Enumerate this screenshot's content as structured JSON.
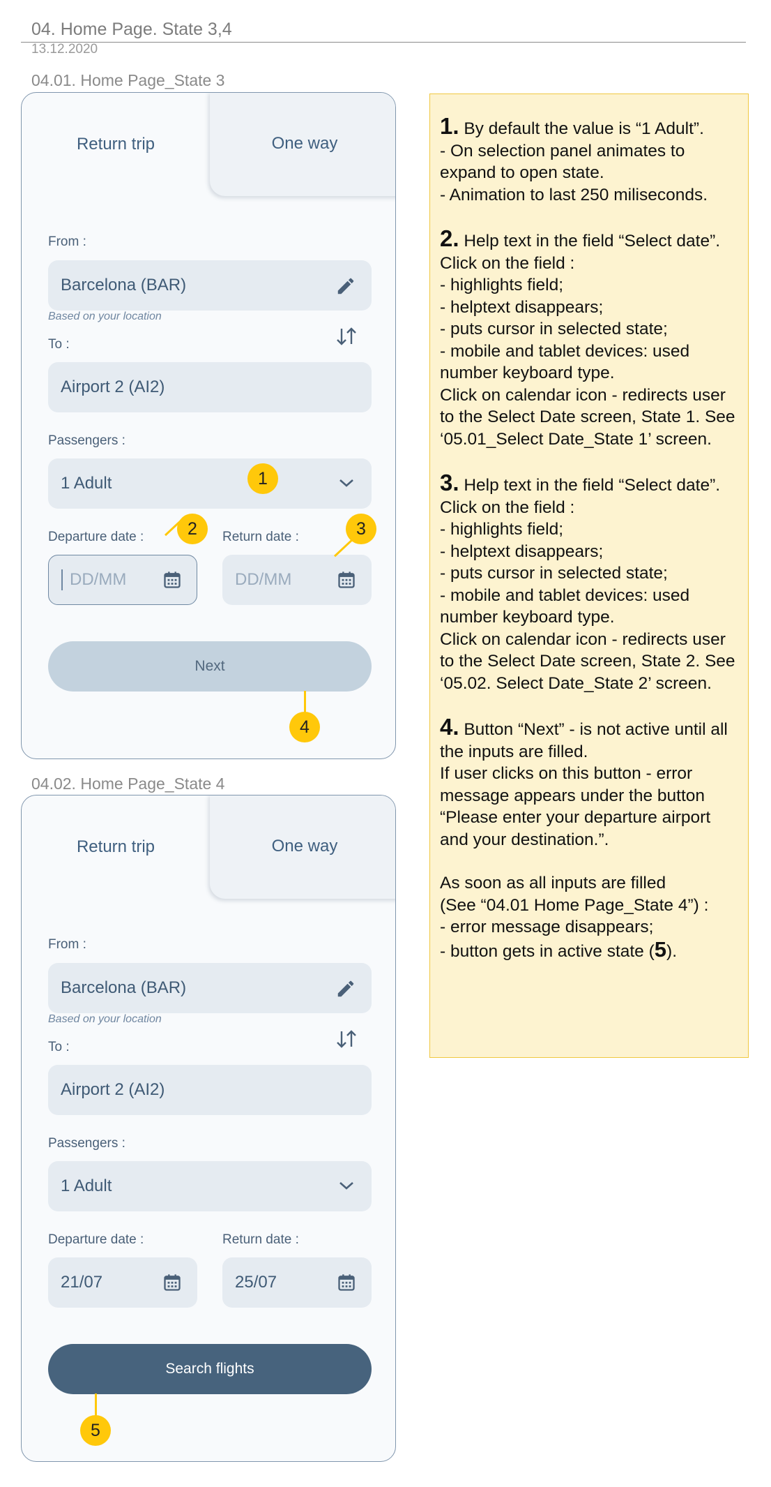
{
  "header": {
    "title": "04. Home Page. State 3,4",
    "date": "13.12.2020"
  },
  "screens": [
    {
      "section_title": "04.01. Home Page_State 3",
      "tabs": {
        "return_trip": "Return trip",
        "one_way": "One way"
      },
      "from_label": "From :",
      "from_value": "Barcelona (BAR)",
      "from_hint": "Based on your location",
      "to_label": "To :",
      "to_value": "Airport 2 (AI2)",
      "passengers_label": "Passengers :",
      "passengers_value": "1 Adult",
      "departure_label": "Departure date :",
      "departure_placeholder": "DD/MM",
      "return_label": "Return date :",
      "return_placeholder": "DD/MM",
      "button_label": "Next"
    },
    {
      "section_title": "04.02. Home Page_State 4",
      "tabs": {
        "return_trip": "Return trip",
        "one_way": "One way"
      },
      "from_label": "From :",
      "from_value": "Barcelona (BAR)",
      "from_hint": "Based on your location",
      "to_label": "To :",
      "to_value": "Airport 2 (AI2)",
      "passengers_label": "Passengers :",
      "passengers_value": "1 Adult",
      "departure_label": "Departure date :",
      "departure_value": "21/07",
      "return_label": "Return date :",
      "return_value": "25/07",
      "button_label": "Search flights"
    }
  ],
  "badges": [
    "1",
    "2",
    "3",
    "4",
    "5"
  ],
  "notes": [
    {
      "num": "1.",
      "text": " By default the value is “1 Adult”.\n- On selection panel animates to expand to open state.\n- Animation to last 250 miliseconds."
    },
    {
      "num": "2.",
      "text": " Help text in the field “Select date”. Click on the field :\n - highlights field;\n - helptext disappears;\n - puts cursor in selected state;\n - mobile and tablet devices: used number keyboard type.\nClick on calendar icon - redirects user to the Select Date screen, State 1. See ‘05.01_Select Date_State 1’ screen."
    },
    {
      "num": "3.",
      "text": " Help text in the field “Select date”. Click on the field :\n - highlights field;\n - helptext disappears;\n - puts cursor in selected state;\n - mobile and tablet devices: used number keyboard type.\nClick on calendar icon - redirects user to the Select Date screen, State 2. See ‘05.02. Select Date_State 2’ screen."
    },
    {
      "num": "4.",
      "text": " Button “Next” - is not active until all the inputs are filled.\nIf user clicks on this button - error message appears under the button “Please enter your departure airport and your destination.”."
    }
  ],
  "note_tail": {
    "text": "As soon as all inputs are filled\n(See “04.01 Home Page_State 4”) :\n - error message disappears;",
    "last_prefix": " - button gets in active state (",
    "last_num": "5",
    "last_suffix": ")."
  },
  "colors": {
    "accent_badge": "#ffc80a",
    "button_active": "#47637d",
    "button_disabled": "#c3d2de",
    "note_background": "#fdf3d0"
  }
}
